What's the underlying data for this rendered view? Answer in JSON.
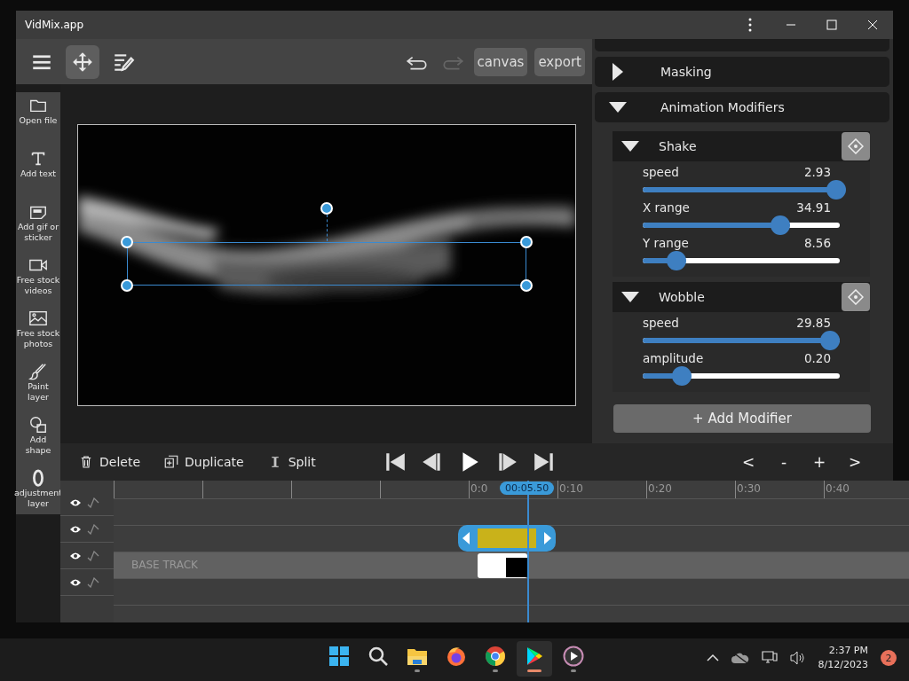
{
  "window": {
    "title": "VidMix.app"
  },
  "toolbar": {
    "tools": [
      {
        "kind": "menu",
        "selected": false
      },
      {
        "kind": "move",
        "selected": true
      },
      {
        "kind": "edit",
        "selected": false
      }
    ],
    "history": [
      {
        "kind": "undo",
        "disabled": false
      },
      {
        "kind": "redo",
        "disabled": true
      }
    ],
    "buttons": [
      "canvas",
      "export"
    ]
  },
  "sidebar": {
    "items": [
      {
        "kind": "folder",
        "label": "Open file"
      },
      {
        "kind": "text",
        "label": "Add text"
      },
      {
        "kind": "gif",
        "label": "Add gif or sticker"
      },
      {
        "kind": "video",
        "label": "Free stock videos"
      },
      {
        "label": "Free stock photos"
      },
      {
        "kind": "brush",
        "label": "Paint layer"
      },
      {
        "kind": "shape",
        "label": "Add shape"
      },
      {
        "kind": "adjust",
        "label": "adjustment layer"
      }
    ]
  },
  "properties": {
    "sections": [
      {
        "title": "Masking",
        "expanded": false
      },
      {
        "title": "Animation Modifiers",
        "expanded": true
      }
    ],
    "modifiers": [
      {
        "name": "Shake",
        "expanded": true,
        "params": [
          {
            "label": "speed",
            "reading": "2.93",
            "level": 0.98
          },
          {
            "label": "X range",
            "reading": "34.91",
            "level": 0.7
          },
          {
            "label": "Y range",
            "reading": "8.56",
            "level": 0.17
          }
        ]
      },
      {
        "name": "Wobble",
        "expanded": true,
        "params": [
          {
            "label": "speed",
            "reading": "29.85",
            "level": 0.95
          },
          {
            "label": "amplitude",
            "reading": "0.20",
            "level": 0.2
          }
        ]
      }
    ],
    "add_button": "+ Add Modifier"
  },
  "timeline": {
    "actions": [
      {
        "kind": "delete",
        "label": "Delete"
      },
      {
        "kind": "duplicate",
        "label": "Duplicate"
      },
      {
        "kind": "split",
        "label": "Split"
      }
    ],
    "transport": [
      {
        "kind": "start"
      },
      {
        "kind": "back"
      },
      {
        "kind": "play"
      },
      {
        "kind": "forward"
      },
      {
        "kind": "end"
      }
    ],
    "zoom": [
      "<",
      "-",
      "+",
      ">"
    ],
    "ticks": [
      "0:0",
      "0:10",
      "0:20",
      "0:30",
      "0:40"
    ],
    "playhead": "00:05.50",
    "tracks": [
      {
        "kind": "empty",
        "selected": false
      },
      {
        "kind": "clip",
        "selected": false
      },
      {
        "kind": "base",
        "label": "BASE TRACK",
        "selected": true
      },
      {
        "kind": "empty",
        "selected": false
      }
    ]
  },
  "taskbar": {
    "apps": [
      {
        "kind": "windows",
        "running": false,
        "active": false
      },
      {
        "kind": "search",
        "running": false,
        "active": false
      },
      {
        "kind": "files",
        "running": true,
        "active": false
      },
      {
        "kind": "firefox",
        "running": false,
        "active": false
      },
      {
        "kind": "chrome",
        "running": true,
        "active": false
      },
      {
        "kind": "play",
        "running": true,
        "active": true
      },
      {
        "kind": "player",
        "running": true,
        "active": false
      }
    ],
    "time": "2:37 PM",
    "date": "8/12/2023",
    "notifications": "2"
  }
}
